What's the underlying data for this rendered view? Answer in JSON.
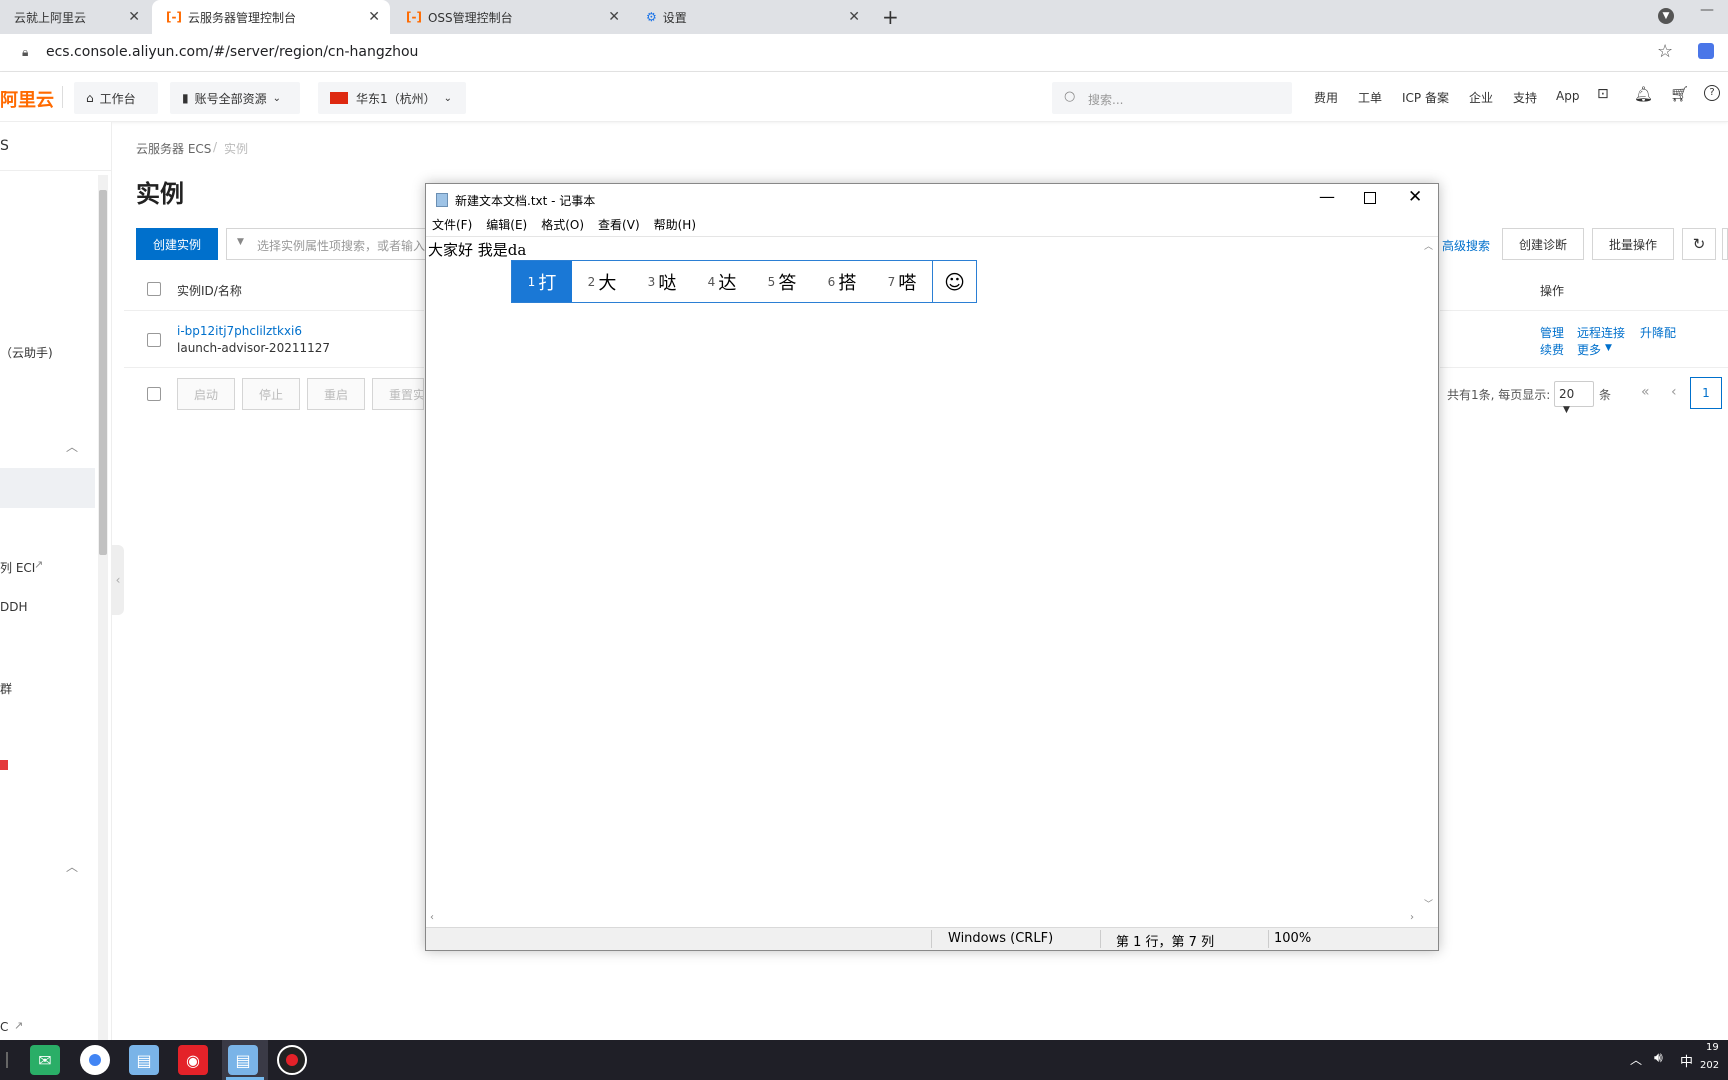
{
  "browser": {
    "tabs": [
      {
        "label": "云就上阿里云"
      },
      {
        "label": "云服务器管理控制台"
      },
      {
        "label": "OSS管理控制台"
      },
      {
        "label": "设置"
      }
    ],
    "url": "ecs.console.aliyun.com/#/server/region/cn-hangzhou"
  },
  "header": {
    "logo": "阿里云",
    "workbench": "工作台",
    "account": "账号全部资源",
    "region": "华东1（杭州）",
    "search_placeholder": "搜索...",
    "links": [
      "费用",
      "工单",
      "ICP 备案",
      "企业",
      "支持",
      "App"
    ]
  },
  "sidebar": {
    "title": "S",
    "items": [
      "（云助手)",
      "列 ECI",
      "DDH",
      "群",
      "C"
    ]
  },
  "main": {
    "breadcrumb_root": "云服务器 ECS",
    "breadcrumb_sep": "/",
    "breadcrumb_current": "实例",
    "page_title": "实例",
    "create_button": "创建实例",
    "search_placeholder": "选择实例属性项搜索，或者输入",
    "advanced_search": "高级搜索",
    "create_diagnosis": "创建诊断",
    "batch_ops": "批量操作",
    "table_header_id": "实例ID/名称",
    "table_header_ops": "操作",
    "row": {
      "id": "i-bp12itj7phclilztkxi6",
      "name": "launch-advisor-20211127",
      "ops": [
        "管理",
        "远程连接",
        "升降配",
        "续费",
        "更多"
      ]
    },
    "bottom_buttons": [
      "启动",
      "停止",
      "重启",
      "重置实"
    ],
    "pagination": {
      "summary": "共有1条, 每页显示:",
      "page_size": "20",
      "unit": "条",
      "current_page": "1"
    }
  },
  "notepad": {
    "title": "新建文本文档.txt - 记事本",
    "menu": [
      "文件(F)",
      "编辑(E)",
      "格式(O)",
      "查看(V)",
      "帮助(H)"
    ],
    "content_text": "大家好 我是da",
    "status_eol": "Windows (CRLF)",
    "status_pos": "第 1 行，第 7 列",
    "status_zoom": "100%"
  },
  "ime": {
    "candidates": [
      {
        "num": "1",
        "char": "打"
      },
      {
        "num": "2",
        "char": "大"
      },
      {
        "num": "3",
        "char": "哒"
      },
      {
        "num": "4",
        "char": "达"
      },
      {
        "num": "5",
        "char": "答"
      },
      {
        "num": "6",
        "char": "搭"
      },
      {
        "num": "7",
        "char": "嗒"
      }
    ]
  },
  "taskbar": {
    "ime_lang": "中",
    "clock_top": "19",
    "clock_bottom": "202"
  }
}
